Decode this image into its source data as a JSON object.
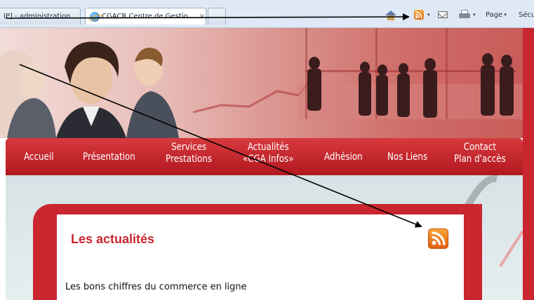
{
  "browser": {
    "tabs": [
      {
        "label": "IP] - administration"
      },
      {
        "label": "CGACR Centre de Gestio..."
      },
      {
        "label": ""
      }
    ],
    "tab_close": "✕",
    "command_bar": {
      "page_label": "Page",
      "security_label": "Sécu",
      "dropdown_arrow": "▾"
    }
  },
  "site": {
    "nav": {
      "accueil": "Accueil",
      "presentation": "Présentation",
      "services_line1": "Services",
      "services_line2": "Prestations",
      "actualites_line1": "Actualités",
      "actualites_line2": "«CGA Infos»",
      "adhesion": "Adhésion",
      "liens": "Nos Liens",
      "contact_line1": "Contact",
      "contact_line2": "Plan d'accès"
    },
    "panel": {
      "title": "Les actualités",
      "article_title": "Les bons chiffres du commerce en ligne"
    }
  },
  "colors": {
    "brand_red": "#c9262f",
    "rss_orange": "#f0781e",
    "browser_chrome": "#dfe9f5"
  },
  "icons": [
    "ie-icon",
    "home-icon",
    "rss-icon",
    "mail-icon",
    "print-icon",
    "rss-feed-icon",
    "arrow-annotation"
  ]
}
